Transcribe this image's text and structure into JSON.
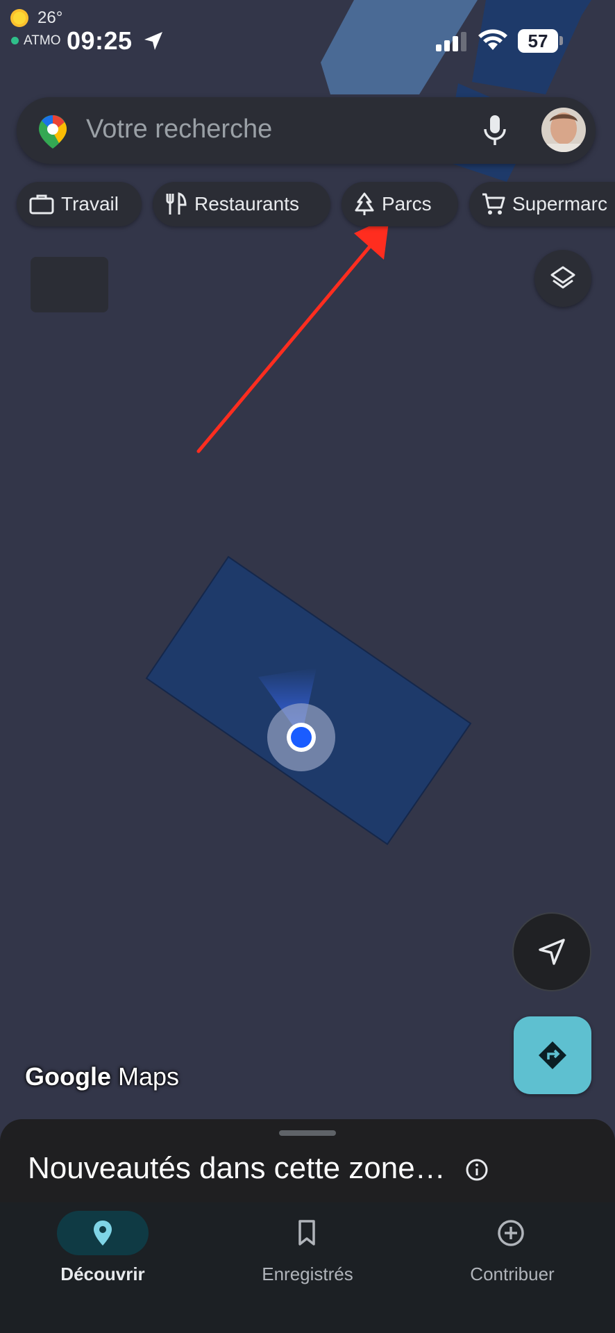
{
  "status_bar": {
    "time": "09:25",
    "battery": "57"
  },
  "search": {
    "placeholder": "Votre recherche"
  },
  "chips": [
    {
      "label": "Travail",
      "icon": "briefcase-icon"
    },
    {
      "label": "Restaurants",
      "icon": "fork-knife-icon"
    },
    {
      "label": "Parcs",
      "icon": "tree-icon"
    },
    {
      "label": "Supermarc",
      "icon": "cart-icon"
    }
  ],
  "weather": {
    "temperature": "26°",
    "air_quality": "ATMO"
  },
  "watermark": {
    "brand": "Google",
    "product": "Maps"
  },
  "sheet": {
    "title": "Nouveautés dans cette zone…"
  },
  "nav": {
    "items": [
      {
        "label": "Découvrir",
        "icon": "location-pin-icon",
        "active": true
      },
      {
        "label": "Enregistrés",
        "icon": "bookmark-icon",
        "active": false
      },
      {
        "label": "Contribuer",
        "icon": "add-circle-icon",
        "active": false
      }
    ]
  },
  "colors": {
    "map_background": "#333649",
    "building_fill": "#1e3a6a",
    "location_dot": "#1a5cff",
    "annotation_arrow": "#ff2d1f",
    "directions_button": "#5ec0d0"
  }
}
